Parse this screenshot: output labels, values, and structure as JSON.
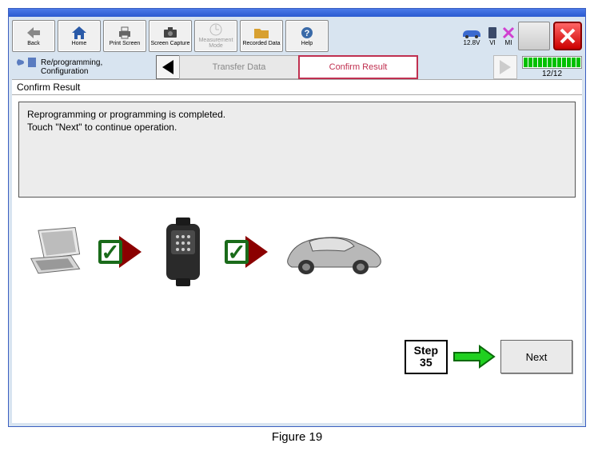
{
  "toolbar": {
    "back": "Back",
    "home": "Home",
    "print": "Print Screen",
    "capture": "Screen Capture",
    "measure": "Measurement Mode",
    "recorded": "Recorded Data",
    "help": "Help"
  },
  "status": {
    "voltage": "12.8V",
    "vi": "VI",
    "mi": "MI"
  },
  "nav": {
    "path_line1": "Re/programming,",
    "path_line2": "Configuration",
    "step_prev": "Transfer Data",
    "step_current": "Confirm Result",
    "progress": "12/12"
  },
  "content": {
    "title": "Confirm Result",
    "msg_line1": "Reprogramming or programming is completed.",
    "msg_line2": "Touch \"Next\" to continue operation.",
    "step_label": "Step",
    "step_num": "35",
    "next": "Next"
  },
  "caption": "Figure 19"
}
